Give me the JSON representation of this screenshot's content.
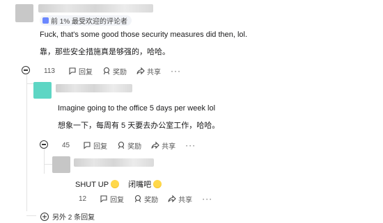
{
  "comments": [
    {
      "badge": "前 1% 最受欢迎的评论者",
      "text_en": "Fuck, that's some good those security measures did then, lol.",
      "text_zh": "靠，那些安全措施真是够强的，哈哈。",
      "votes": "113",
      "reply_label": "回复",
      "award_label": "奖励",
      "share_label": "共享",
      "avatar_color": "#c8c8c8"
    },
    {
      "text_en": "Imagine going to the office 5 days per week lol",
      "text_zh": "想象一下，每周有 5 天要去办公室工作，哈哈。",
      "votes": "45",
      "reply_label": "回复",
      "award_label": "奖励",
      "share_label": "共享",
      "avatar_color": "#5dd6c4"
    },
    {
      "text_en": "SHUT UP",
      "text_zh": "闭嘴吧",
      "votes": "12",
      "reply_label": "回复",
      "award_label": "奖励",
      "share_label": "共享",
      "avatar_color": "#c6c6c6"
    }
  ],
  "more_replies": "另外 2 条回复",
  "more_glyph": "···"
}
